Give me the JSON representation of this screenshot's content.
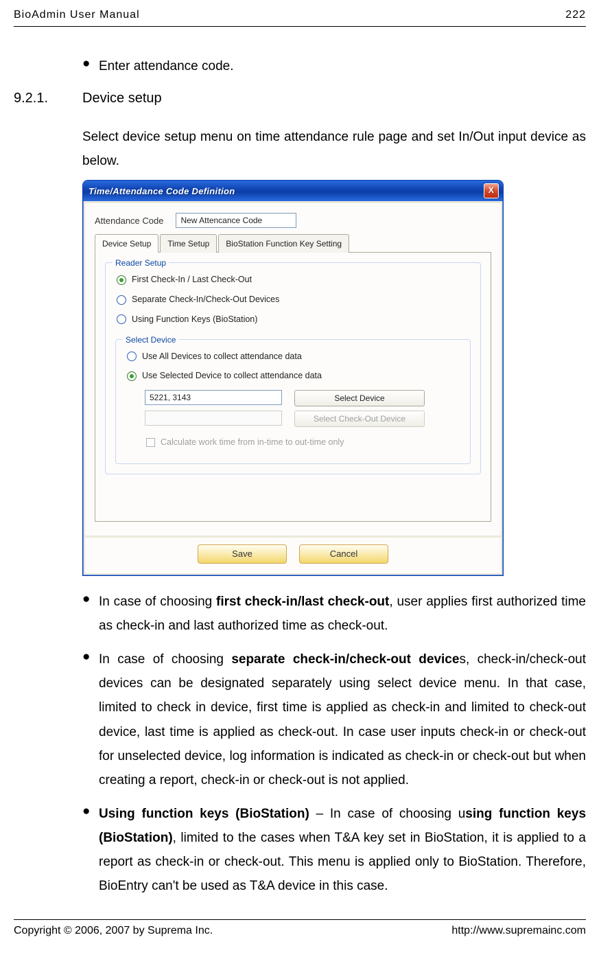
{
  "header": {
    "title": "BioAdmin  User  Manual",
    "page_no": "222"
  },
  "footer": {
    "copyright": "Copyright © 2006, 2007 by Suprema Inc.",
    "url": "http://www.supremainc.com"
  },
  "bullets_top": [
    "Enter attendance code."
  ],
  "section": {
    "number": "9.2.1.",
    "title": "Device setup"
  },
  "para1": "Select device setup menu on time attendance rule page and set In/Out input device as below.",
  "dialog": {
    "title": "Time/Attendance Code Definition",
    "close": "X",
    "field_label": "Attendance Code",
    "field_value": "New Attencance Code",
    "tabs": [
      "Device Setup",
      "Time Setup",
      "BioStation Function Key Setting"
    ],
    "group1_title": "Reader Setup",
    "radios1": [
      {
        "label": "First Check-In / Last Check-Out",
        "checked": true
      },
      {
        "label": "Separate Check-In/Check-Out Devices",
        "checked": false
      },
      {
        "label": "Using Function Keys (BioStation)",
        "checked": false
      }
    ],
    "group2_title": "Select Device",
    "radios2": [
      {
        "label": "Use All Devices to collect attendance data",
        "checked": false
      },
      {
        "label": "Use Selected Device to collect attendance data",
        "checked": true
      }
    ],
    "dev_value": "5221, 3143",
    "btn_select_device": "Select Device",
    "btn_select_checkout": "Select Check-Out Device",
    "chk_label": "Calculate work time from in-time to out-time only",
    "btn_save": "Save",
    "btn_cancel": "Cancel"
  },
  "bullets_bottom": [
    {
      "pre": "In case of choosing ",
      "bold": "first check-in/last check-out",
      "post": ", user applies first authorized time as check-in and last authorized time as check-out."
    },
    {
      "pre": "In case of choosing ",
      "bold": "separate check-in/check-out device",
      "post": "s, check-in/check-out devices can be designated separately using select device menu. In that case, limited to check in device, first time is applied as check-in and limited to check-out device, last time is applied as check-out. In case user inputs check-in or check-out for unselected device, log information is indicated as check-in or check-out but when creating a report, check-in or check-out is not applied."
    },
    {
      "preBold": "Using function keys (BioStation)",
      "mid": " – In case of choosing u",
      "bold2": "sing function keys (BioStation)",
      "post": ", limited to the cases when T&A key set in BioStation, it is applied to a report as check-in or check-out. This menu is applied only to BioStation. Therefore, BioEntry can't be used as T&A device in this case."
    }
  ]
}
